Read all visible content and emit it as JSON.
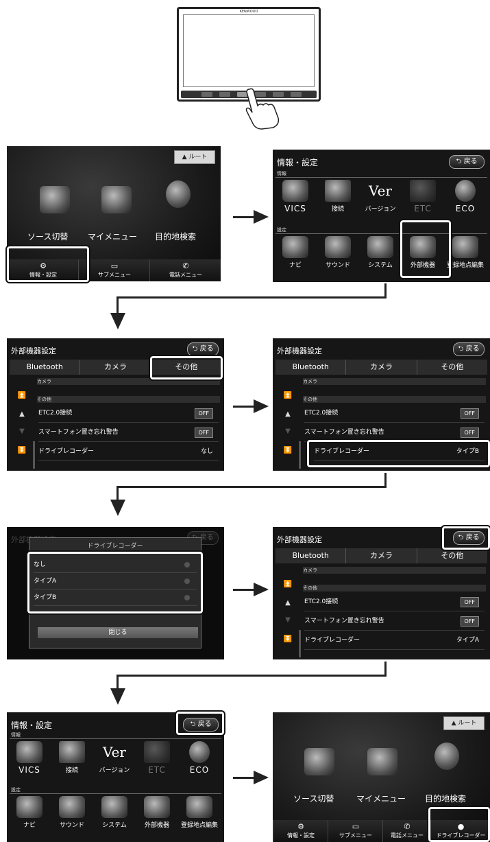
{
  "device": {
    "brand": "KENWOOD"
  },
  "home": {
    "route_label": "ルート",
    "icons": [
      "ソース切替",
      "マイメニュー",
      "目的地検索"
    ],
    "bottom": [
      "情報・設定",
      "サブメニュー",
      "電話メニュー"
    ],
    "bottom_final": [
      "情報・設定",
      "サブメニュー",
      "電話メニュー",
      "ドライブレコーダー"
    ]
  },
  "info": {
    "title": "情報・設定",
    "back": "戻る",
    "sec_info": "情報",
    "sec_settings": "設定",
    "info_icons": [
      "VICS",
      "接続",
      "バージョン",
      "ETC",
      "ECO"
    ],
    "setting_icons": [
      "ナビ",
      "サウンド",
      "システム",
      "外部機器",
      "登録地点編集"
    ]
  },
  "ext": {
    "title": "外部機器設定",
    "back": "戻る",
    "tabs": [
      "Bluetooth",
      "カメラ",
      "その他"
    ],
    "sub_camera": "カメラ",
    "sub_other": "その他",
    "rows": [
      {
        "label": "ETC2.0接続",
        "value": "OFF"
      },
      {
        "label": "スマートフォン置き忘れ警告",
        "value": "OFF"
      },
      {
        "label": "ドライブレコーダー",
        "value": "なし"
      }
    ],
    "dr_typeB": "タイプB",
    "dr_typeA": "タイプA"
  },
  "popup": {
    "title": "ドライブレコーダー",
    "options": [
      "なし",
      "タイプA",
      "タイプB"
    ],
    "close": "閉じる"
  }
}
